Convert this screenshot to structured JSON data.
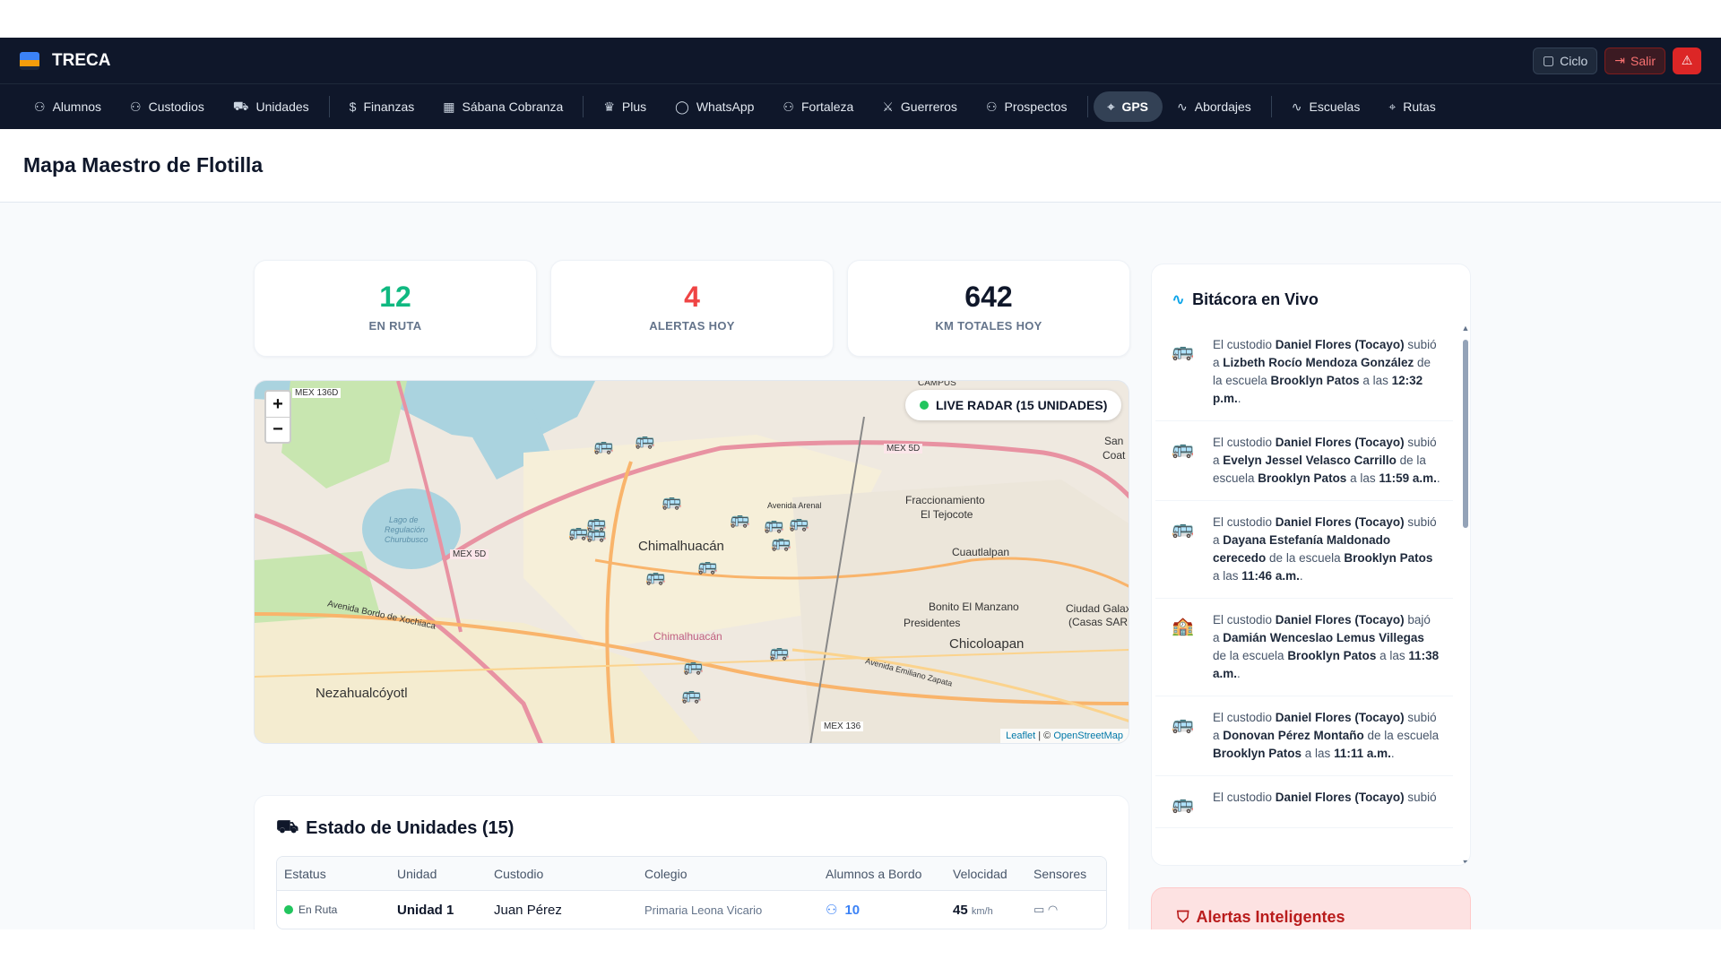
{
  "app": {
    "name": "TRECA"
  },
  "header": {
    "ciclo": "Ciclo",
    "salir": "Salir"
  },
  "nav": [
    {
      "label": "Alumnos",
      "icon": "users-icon"
    },
    {
      "label": "Custodios",
      "icon": "users-icon"
    },
    {
      "label": "Unidades",
      "icon": "bus-icon"
    },
    {
      "label": "Finanzas",
      "icon": "dollar-icon"
    },
    {
      "label": "Sábana Cobranza",
      "icon": "calendar-icon"
    },
    {
      "label": "Plus",
      "icon": "crown-icon"
    },
    {
      "label": "WhatsApp",
      "icon": "chat-icon"
    },
    {
      "label": "Fortaleza",
      "icon": "users-icon"
    },
    {
      "label": "Guerreros",
      "icon": "swords-icon"
    },
    {
      "label": "Prospectos",
      "icon": "users-icon"
    },
    {
      "label": "GPS",
      "icon": "pin-icon",
      "active": true
    },
    {
      "label": "Abordajes",
      "icon": "activity-icon"
    },
    {
      "label": "Escuelas",
      "icon": "activity-icon"
    },
    {
      "label": "Rutas",
      "icon": "pin-icon"
    }
  ],
  "page": {
    "title": "Mapa Maestro de Flotilla"
  },
  "stats": [
    {
      "value": "12",
      "label": "EN RUTA",
      "color": "#10b981"
    },
    {
      "value": "4",
      "label": "ALERTAS HOY",
      "color": "#ef4444"
    },
    {
      "value": "642",
      "label": "KM TOTALES HOY",
      "color": "#0f172a"
    }
  ],
  "map": {
    "radar": "LIVE RADAR (15 UNIDADES)",
    "zoom_in": "+",
    "zoom_out": "−",
    "attribution_leaflet": "Leaflet",
    "attribution_sep": " | © ",
    "attribution_osm": "OpenStreetMap",
    "labels": {
      "chimalhuacan": "Chimalhuacán",
      "chimalhuacan2": "Chimalhuacán",
      "nezahualcoyotl": "Nezahualcóyotl",
      "tejocote": "Fraccionamiento",
      "tejocote2": "El Tejocote",
      "cuautlalpan": "Cuautlalpan",
      "bonito": "Bonito El Manzano",
      "presidentes": "Presidentes",
      "chicoloapan": "Chicoloapan",
      "galaxia": "Ciudad Galax",
      "galaxia2": "(Casas SARE",
      "san": "San",
      "coat": "Coat",
      "campus": "CAMPUS",
      "mex136d": "MEX 136D",
      "mex5d": "MEX 5D",
      "mex5d2": "MEX 5D",
      "mex136": "MEX 136",
      "lago": "Lago de",
      "lago2": "Regulación",
      "lago3": "Churubusco",
      "xochiaca": "Avenida Bordo de Xochiaca",
      "arenal": "Avenida Arenal",
      "zapata": "Avenida Emiliano Zapata"
    }
  },
  "units": {
    "title": "Estado de Unidades (15)",
    "columns": [
      "Estatus",
      "Unidad",
      "Custodio",
      "Colegio",
      "Alumnos a Bordo",
      "Velocidad",
      "Sensores"
    ],
    "rows": [
      {
        "estatus": "En Ruta",
        "unidad": "Unidad 1",
        "custodio": "Juan Pérez",
        "colegio": "Primaria Leona Vicario",
        "alumnos": "10",
        "velocidad": "45",
        "unit": "km/h"
      }
    ]
  },
  "bitacora": {
    "title": "Bitácora en Vivo",
    "entries": [
      {
        "icon": "bus-icon",
        "a": "El custodio ",
        "custodio": "Daniel Flores (Tocayo)",
        "b": " subió a ",
        "alumno": "Lizbeth Rocío Mendoza González",
        "c": " de la escuela ",
        "escuela": "Brooklyn Patos",
        "d": " a las ",
        "hora": "12:32 p.m.",
        "e": "."
      },
      {
        "icon": "bus-icon",
        "a": "El custodio ",
        "custodio": "Daniel Flores (Tocayo)",
        "b": " subió a ",
        "alumno": "Evelyn Jessel Velasco Carrillo",
        "c": " de la escuela ",
        "escuela": "Brooklyn Patos",
        "d": " a las ",
        "hora": "11:59 a.m.",
        "e": "."
      },
      {
        "icon": "bus-icon",
        "a": "El custodio ",
        "custodio": "Daniel Flores (Tocayo)",
        "b": " subió a ",
        "alumno": "Dayana Estefanía Maldonado cerecedo",
        "c": " de la escuela ",
        "escuela": "Brooklyn Patos",
        "d": " a las ",
        "hora": "11:46 a.m.",
        "e": "."
      },
      {
        "icon": "school-icon",
        "a": "El custodio ",
        "custodio": "Daniel Flores (Tocayo)",
        "b": " bajó a ",
        "alumno": "Damián Wenceslao Lemus Villegas",
        "c": " de la escuela ",
        "escuela": "Brooklyn Patos",
        "d": " a las ",
        "hora": "11:38 a.m.",
        "e": "."
      },
      {
        "icon": "bus-icon",
        "a": "El custodio ",
        "custodio": "Daniel Flores (Tocayo)",
        "b": " subió a ",
        "alumno": "Donovan Pérez Montaño",
        "c": " de la escuela ",
        "escuela": "Brooklyn Patos",
        "d": " a las ",
        "hora": "11:11 a.m.",
        "e": "."
      },
      {
        "icon": "bus-icon",
        "a": "El custodio ",
        "custodio": "Daniel Flores (Tocayo)",
        "b": " subió",
        "alumno": "",
        "c": "",
        "escuela": "",
        "d": "",
        "hora": "",
        "e": ""
      }
    ]
  },
  "alertas": {
    "title": "Alertas Inteligentes"
  }
}
